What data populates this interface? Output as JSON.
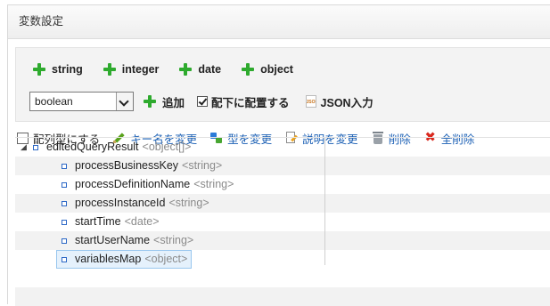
{
  "panel": {
    "title": "変数設定"
  },
  "type_buttons": [
    "string",
    "integer",
    "date",
    "object"
  ],
  "controls": {
    "type_select_value": "boolean",
    "add_label": "追加",
    "place_under_label": "配下に配置する",
    "place_under_checked": true,
    "json_input_label": "JSON入力",
    "json_icon_text": "JSON"
  },
  "actions": {
    "array_type_label": "配列型にする",
    "rename_key_label": "キー名を変更",
    "change_type_label": "型を変更",
    "change_desc_label": "説明を変更",
    "delete_label": "削除",
    "delete_all_label": "全削除"
  },
  "tree": {
    "root": {
      "name": "editedQueryResult",
      "type": "<object[]>",
      "expanded": true
    },
    "children": [
      {
        "name": "processBusinessKey",
        "type": "<string>"
      },
      {
        "name": "processDefinitionName",
        "type": "<string>"
      },
      {
        "name": "processInstanceId",
        "type": "<string>"
      },
      {
        "name": "startTime",
        "type": "<date>"
      },
      {
        "name": "startUserName",
        "type": "<string>"
      },
      {
        "name": "variablesMap",
        "type": "<object>",
        "selected": true
      }
    ]
  },
  "colors": {
    "accent_link": "#1a5fb4",
    "plus_green": "#2eaa2e",
    "delete_red": "#d9281e",
    "selection_bg": "#e5f1fc"
  }
}
